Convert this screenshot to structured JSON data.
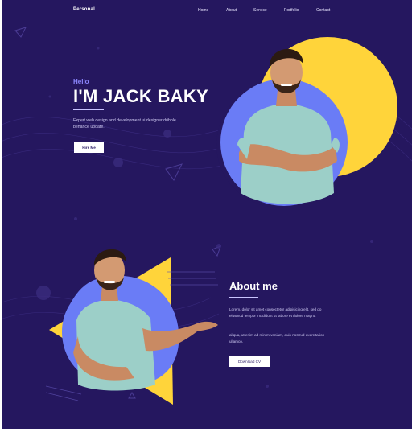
{
  "header": {
    "logo": "Personal",
    "nav": [
      "Home",
      "About",
      "Service",
      "Portfolio",
      "Contact"
    ],
    "active_nav": "Home"
  },
  "hero": {
    "greeting": "Hello",
    "title": "I'M JACK BAKY",
    "description": "Expert web design and development ui designer dribble behance update.",
    "button_label": "Hire Me"
  },
  "about": {
    "title": "About me",
    "paragraph1": "Lorem, dolor sit amet consectetur adipisicing elit, sed do eiusmod tempor incididunt ut labore et dolore magna",
    "paragraph2": "aliqua, ut enim ad minim veniam, quis nostrud exercitation ullamco.",
    "button_label": "Download CV"
  },
  "colors": {
    "background": "#25175f",
    "accent_blue": "#6a7cf6",
    "accent_yellow": "#ffd43a",
    "text_light": "#ffffff"
  }
}
